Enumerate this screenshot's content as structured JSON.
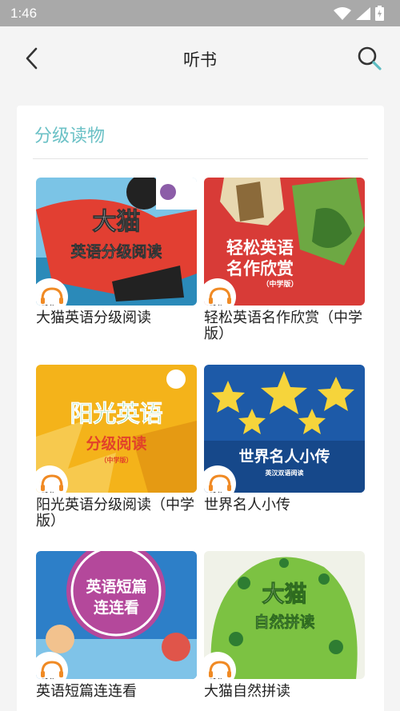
{
  "status_bar": {
    "time": "1:46"
  },
  "app_bar": {
    "title": "听书"
  },
  "section": {
    "title": "分级读物"
  },
  "books": [
    {
      "title": "大猫英语分级阅读",
      "cover_line1": "大猫",
      "cover_line2": "英语分级阅读",
      "badge": "听书",
      "bg": "#2b8ab9"
    },
    {
      "title": "轻松英语名作欣赏（中学版）",
      "cover_line1": "轻松英语",
      "cover_line2": "名作欣赏",
      "cover_line3": "（中学版）",
      "badge": "听书",
      "bg": "#d83b37"
    },
    {
      "title": "阳光英语分级阅读（中学版）",
      "cover_line1": "阳光英语",
      "cover_line2": "分级阅读",
      "cover_line3": "（中学版）",
      "badge": "听书",
      "bg": "#f4b31a"
    },
    {
      "title": "世界名人小传",
      "cover_line1": "世界名人小传",
      "cover_line2": "英汉双语阅读",
      "badge": "听书",
      "bg": "#1d5aa8"
    },
    {
      "title": "英语短篇连连看",
      "cover_line1": "英语短篇",
      "cover_line2": "连连看",
      "badge": "听书",
      "bg": "#2d7fc8"
    },
    {
      "title": "大猫自然拼读",
      "cover_line1": "大猫",
      "cover_line2": "自然拼读",
      "badge": "听书",
      "bg": "#f0f2e8"
    }
  ],
  "colors": {
    "accent": "#6bc1c6",
    "status_bar": "#a9a9a9"
  }
}
